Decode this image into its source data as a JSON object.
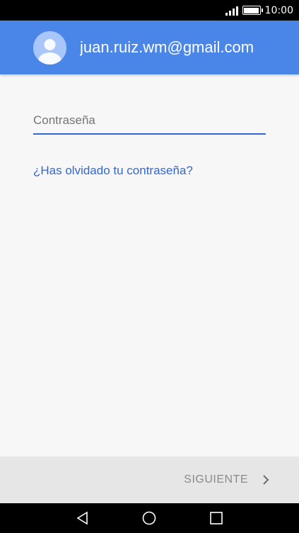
{
  "status_bar": {
    "time": "10:00",
    "signal_icon": "signal-icon",
    "battery_icon": "battery-icon"
  },
  "header": {
    "account_email": "juan.ruiz.wm@gmail.com",
    "avatar_icon": "avatar-icon",
    "background_color": "#4a86e8"
  },
  "form": {
    "password_placeholder": "Contraseña",
    "password_value": "",
    "forgot_password_link": "¿Has olvidado tu contraseña?"
  },
  "footer": {
    "next_label": "SIGUIENTE",
    "next_icon": "chevron-right-icon"
  },
  "nav_bar": {
    "back_icon": "back-icon",
    "home_icon": "home-icon",
    "recent_icon": "recent-apps-icon"
  },
  "colors": {
    "accent": "#3367d6",
    "header_blue": "#4a86e8"
  }
}
